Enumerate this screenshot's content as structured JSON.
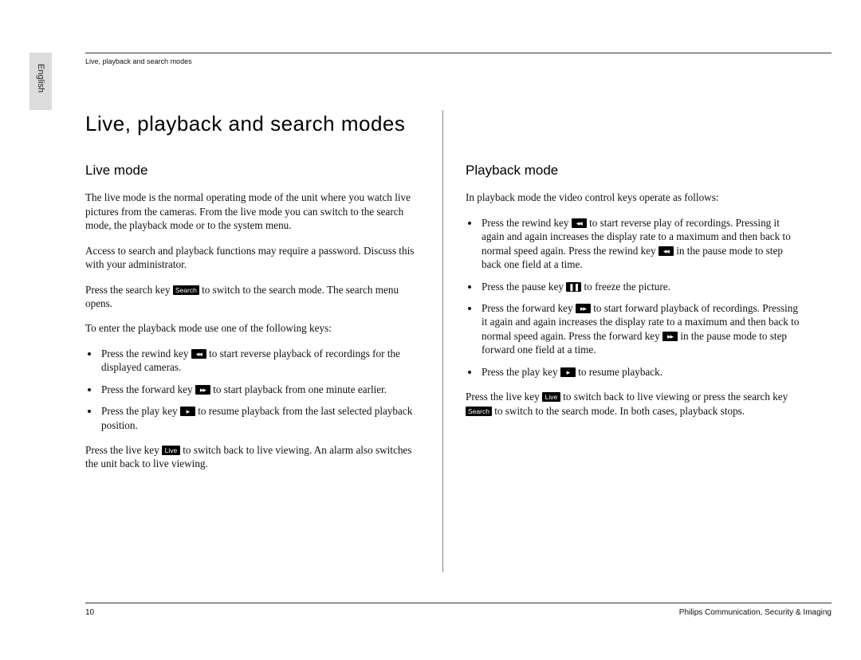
{
  "lang_tab": "English",
  "header": {
    "running_title": "Live, playback and search modes"
  },
  "title": "Live, playback and search modes",
  "left": {
    "heading": "Live mode",
    "p1": "The live mode is the normal operating mode of the unit where you watch live pictures from the cameras. From the live mode you can switch to the search mode, the playback mode or to the system menu.",
    "p2": "Access to search and playback functions may require a password. Discuss this with your administrator.",
    "p3a": "Press the search key ",
    "p3b": " to switch to the search mode. The search menu opens.",
    "p4": "To enter the playback mode use one of the following keys:",
    "b1a": "Press the rewind key ",
    "b1b": " to start reverse playback of recordings for the displayed cameras.",
    "b2a": "Press the forward key ",
    "b2b": " to start playback from one minute earlier.",
    "b3a": "Press the play key ",
    "b3b": " to resume playback from the last selected playback position.",
    "p5a": "Press the live key ",
    "p5b": " to switch back to live viewing. An alarm also switches the unit back to live viewing."
  },
  "right": {
    "heading": "Playback mode",
    "p1": "In playback mode the video control keys operate as follows:",
    "b1a": "Press the rewind key ",
    "b1b": " to start reverse play of recordings. Pressing it again and again increases the display rate to a maximum and then back to normal speed again. Press the rewind key ",
    "b1c": " in the pause mode to step back one field at a time.",
    "b2a": "Press the pause key ",
    "b2b": " to freeze the picture.",
    "b3a": "Press the forward key ",
    "b3b": " to start forward playback of recordings. Pressing it again and again increases the display rate to a maximum and then back to normal speed again. Press the forward key ",
    "b3c": " in the pause mode to step forward one field at a time.",
    "b4a": "Press the play key ",
    "b4b": " to resume playback.",
    "p2a": "Press the live key ",
    "p2b": " to switch back to live viewing or press the search key ",
    "p2c": " to switch to the search mode. In both cases, playback stops."
  },
  "keys": {
    "search": "Search",
    "live": "Live",
    "rewind": "◂◂",
    "forward": "▸▸",
    "play": "▸",
    "pause": "❚❚"
  },
  "footer": {
    "page": "10",
    "right": "Philips Communication, Security & Imaging"
  }
}
